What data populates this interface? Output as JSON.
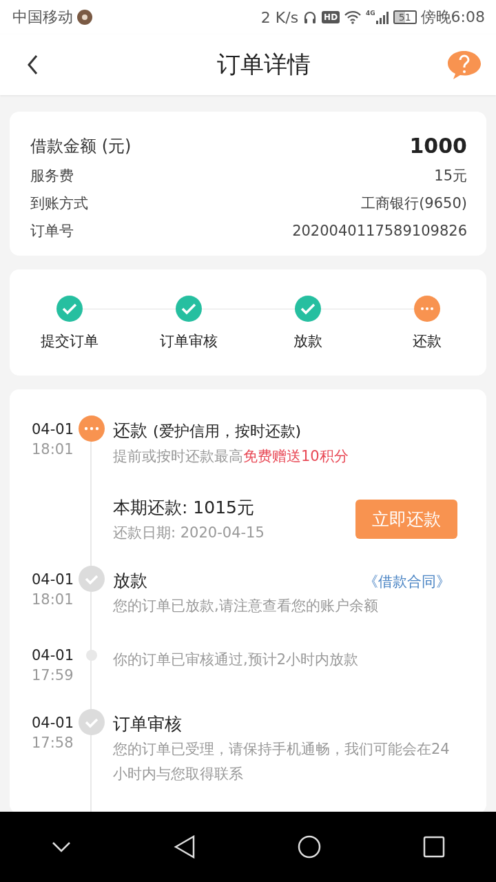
{
  "status_bar": {
    "carrier": "中国移动",
    "speed": "2 K/s",
    "hd": "HD",
    "network": "4G",
    "battery": "51",
    "time": "傍晚6:08"
  },
  "header": {
    "title": "订单详情"
  },
  "summary": {
    "amount_label": "借款金额 (元)",
    "amount": "1000",
    "rows": [
      {
        "label": "服务费",
        "value": "15元"
      },
      {
        "label": "到账方式",
        "value": "工商银行(9650)"
      },
      {
        "label": "订单号",
        "value": "2020040117589109826"
      }
    ]
  },
  "steps": [
    {
      "label": "提交订单",
      "done": true
    },
    {
      "label": "订单审核",
      "done": true
    },
    {
      "label": "放款",
      "done": true
    },
    {
      "label": "还款",
      "done": false
    }
  ],
  "timeline": [
    {
      "kind": "step",
      "done": false,
      "date": "04-01",
      "time": "18:01",
      "title": "还款",
      "note": "(爱护信用，按时还款)",
      "subtitle": "提前或按时还款最高",
      "highlight": "免费赠送10积分",
      "payment": {
        "amount": "本期还款: 1015元",
        "due": "还款日期: 2020-04-15",
        "button": "立即还款"
      }
    },
    {
      "kind": "step",
      "done": true,
      "date": "04-01",
      "time": "18:01",
      "title": "放款",
      "link": "《借款合同》",
      "subtitle": "您的订单已放款,请注意查看您的账户余额"
    },
    {
      "kind": "note",
      "date": "04-01",
      "time": "17:59",
      "subtitle": "你的订单已审核通过,预计2小时内放款"
    },
    {
      "kind": "step",
      "done": true,
      "date": "04-01",
      "time": "17:58",
      "title": "订单审核",
      "subtitle": "您的订单已受理，请保持手机通畅，我们可能会在24小时内与您取得联系"
    }
  ]
}
